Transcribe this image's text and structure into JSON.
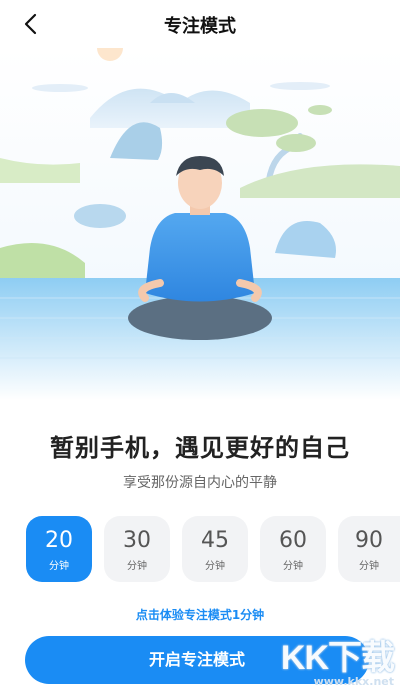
{
  "header": {
    "title": "专注模式",
    "back_icon": "chevron-left-icon"
  },
  "hero": {
    "headline": "暂别手机，遇见更好的自己",
    "subline": "享受那份源自内心的平静"
  },
  "durations": [
    {
      "value": "20",
      "unit": "分钟",
      "selected": true
    },
    {
      "value": "30",
      "unit": "分钟",
      "selected": false
    },
    {
      "value": "45",
      "unit": "分钟",
      "selected": false
    },
    {
      "value": "60",
      "unit": "分钟",
      "selected": false
    },
    {
      "value": "90",
      "unit": "分钟",
      "selected": false
    }
  ],
  "trial_link": "点击体验专注模式1分钟",
  "start_button": "开启专注模式",
  "watermark": {
    "logo": "KK下载",
    "url": "www.kkx.net"
  },
  "colors": {
    "accent": "#1a8cf4",
    "chip_bg": "#f2f3f5"
  }
}
